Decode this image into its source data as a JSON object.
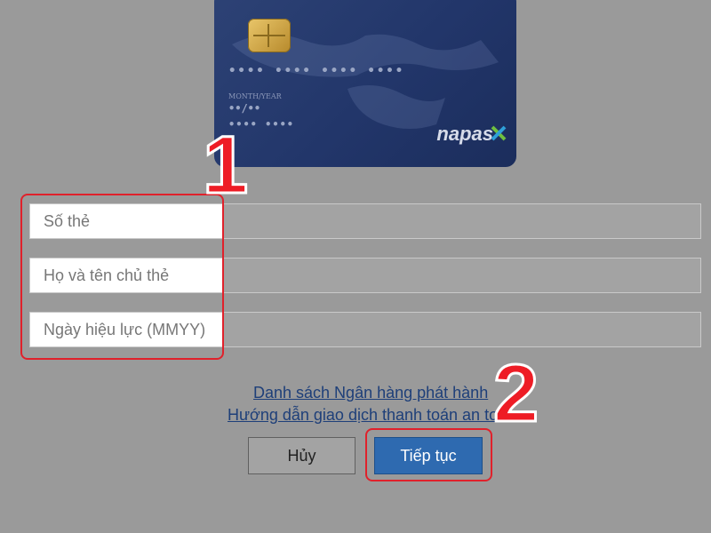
{
  "card": {
    "number_mask": "•••• •••• •••• ••••",
    "expiry_label": "MONTH/YEAR",
    "expiry_mask": "••/••",
    "name_mask": "•••• ••••",
    "brand": "napas",
    "chip_icon": "chip-icon",
    "colors": {
      "card_bg": "#22366a",
      "chip": "#d4a84a"
    }
  },
  "form": {
    "card_number_placeholder": "Số thẻ",
    "cardholder_name_placeholder": "Họ và tên chủ thẻ",
    "valid_date_placeholder": "Ngày hiệu lực (MMYY)"
  },
  "links": {
    "issuer_banks": "Danh sách Ngân hàng phát hành",
    "safe_payment_guide": "Hướng dẫn giao dịch thanh toán an toàn"
  },
  "buttons": {
    "cancel": "Hủy",
    "continue": "Tiếp tục"
  },
  "annotations": {
    "step1": "1",
    "step2": "2",
    "highlight_color": "#e0212b"
  }
}
